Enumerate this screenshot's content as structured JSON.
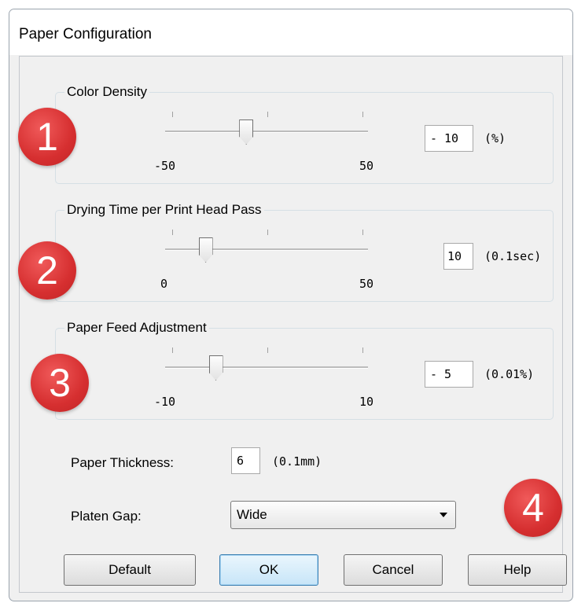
{
  "window": {
    "title": "Paper Configuration"
  },
  "color_density": {
    "label": "Color Density",
    "min_label": "-50",
    "max_label": "50",
    "sign": "-",
    "value": "10",
    "unit": "(%)",
    "slider_fraction": 0.4,
    "badge": "1"
  },
  "drying_time": {
    "label": "Drying Time per Print Head Pass",
    "min_label": "0",
    "max_label": "50",
    "sign": "",
    "value": "10",
    "unit": "(0.1sec)",
    "slider_fraction": 0.2,
    "badge": "2"
  },
  "paper_feed": {
    "label": "Paper Feed Adjustment",
    "min_label": "-10",
    "max_label": "10",
    "sign": "-",
    "value": "5",
    "unit": "(0.01%)",
    "slider_fraction": 0.25,
    "badge": "3"
  },
  "paper_thickness": {
    "label": "Paper Thickness:",
    "value": "6",
    "unit": "(0.1mm)"
  },
  "platen_gap": {
    "label": "Platen Gap:",
    "selected": "Wide"
  },
  "badge4": "4",
  "buttons": {
    "default": "Default",
    "ok": "OK",
    "cancel": "Cancel",
    "help": "Help"
  },
  "colors": {
    "badge": "#d62f30",
    "ok_border": "#3c7fb1"
  }
}
